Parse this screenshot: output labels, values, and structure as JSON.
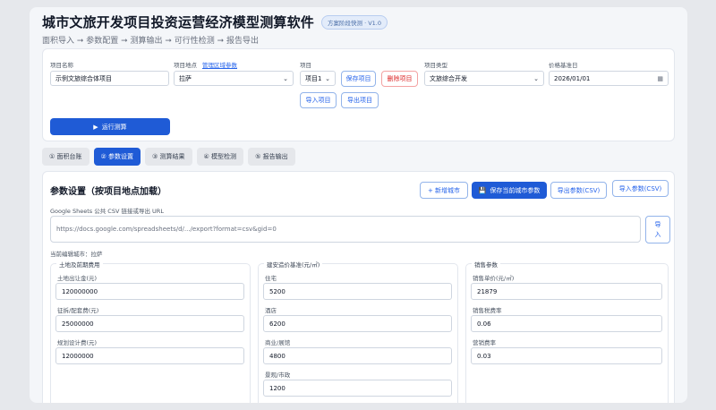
{
  "header": {
    "title": "城市文旅开发项目投资运营经济模型测算软件",
    "version": "方案阶段快测 · V1.0",
    "workflow": "面积导入 ➞ 参数配置 ➞ 测算输出 ➞ 可行性检测 ➞ 报告导出"
  },
  "project": {
    "name_label": "项目名称",
    "name_value": "示例文旅综合体项目",
    "location_label": "项目地点",
    "location_link": "管理区域参数",
    "location_value": "拉萨",
    "project_label": "项目",
    "project_select": "项目1",
    "save_btn": "保存项目",
    "delete_btn": "删除项目",
    "import_btn": "导入项目",
    "export_btn": "导出项目",
    "type_label": "项目类型",
    "type_value": "文旅综合开发",
    "date_label": "价格基准日",
    "date_value": "2026/01/01",
    "run_btn": "运行测算",
    "run_icon": "▶"
  },
  "tabs": [
    {
      "label": "① 面积台账",
      "active": false
    },
    {
      "label": "② 参数设置",
      "active": true
    },
    {
      "label": "③ 测算结果",
      "active": false
    },
    {
      "label": "④ 模型检测",
      "active": false
    },
    {
      "label": "⑤ 报告输出",
      "active": false
    }
  ],
  "params": {
    "title": "参数设置（按项目地点加载）",
    "add_city_btn": "+ 新增城市",
    "save_city_btn": "保存当前城市参数",
    "save_city_icon": "💾",
    "export_csv_btn": "导出参数(CSV)",
    "import_csv_btn": "导入参数(CSV)",
    "sheets_label": "Google Sheets 公共 CSV 链接或导出 URL",
    "sheets_placeholder": "https://docs.google.com/spreadsheets/d/.../export?format=csv&gid=0",
    "import_btn_line1": "导",
    "import_btn_line2": "入",
    "current_city": "当前编辑城市：拉萨"
  },
  "groups": {
    "land": {
      "title": "土地及前期费用",
      "fields": [
        {
          "label": "土地出让金(元)",
          "value": "120000000"
        },
        {
          "label": "征拆/配套费(元)",
          "value": "25000000"
        },
        {
          "label": "规划设计费(元)",
          "value": "12000000"
        }
      ]
    },
    "build": {
      "title": "建安造价基准(元/㎡)",
      "fields": [
        {
          "label": "住宅",
          "value": "5200"
        },
        {
          "label": "酒店",
          "value": "6200"
        },
        {
          "label": "商业/展馆",
          "value": "4800"
        },
        {
          "label": "景观/市政",
          "value": "1200"
        }
      ]
    },
    "sales": {
      "title": "销售参数",
      "fields": [
        {
          "label": "销售单价(元/㎡)",
          "value": "21879"
        },
        {
          "label": "销售税费率",
          "value": "0.06"
        },
        {
          "label": "营销费率",
          "value": "0.03"
        }
      ]
    }
  }
}
